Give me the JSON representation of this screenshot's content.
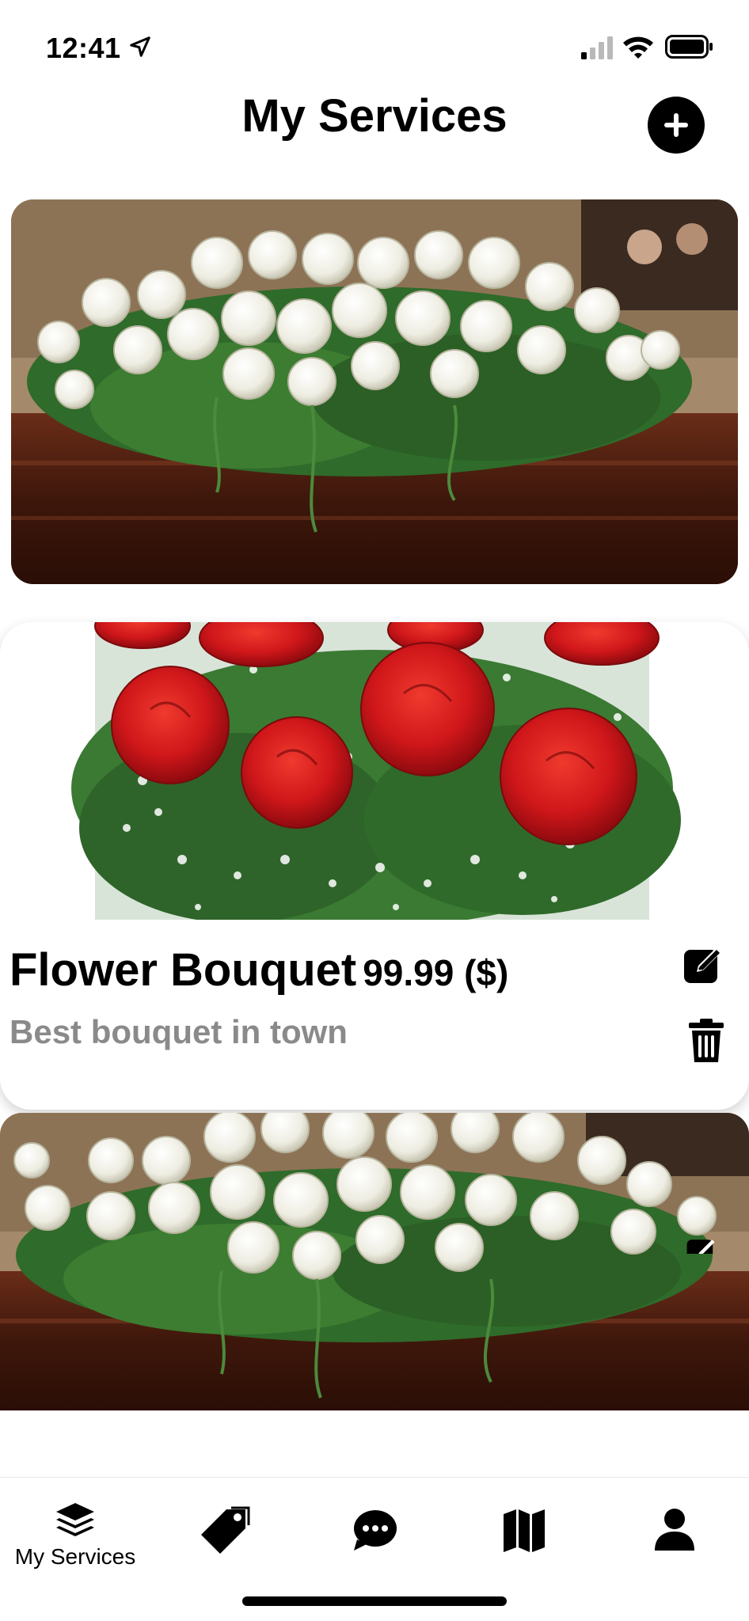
{
  "status_bar": {
    "time": "12:41",
    "location_icon": "location-arrow-icon",
    "signal_icon": "cellular-signal-icon",
    "wifi_icon": "wifi-icon",
    "battery_icon": "battery-icon"
  },
  "header": {
    "title": "My Services",
    "add_icon": "plus-circle-icon"
  },
  "services": [
    {
      "image": "white roses casket spray",
      "visible_info": false
    },
    {
      "image": "red roses bouquet",
      "name": "Flower Bouquet",
      "price": "99.99 ($)",
      "description": "Best bouquet in town",
      "edit_icon": "edit-icon",
      "delete_icon": "trash-icon"
    },
    {
      "image": "white roses casket spray",
      "visible_info": false
    }
  ],
  "tab_bar": {
    "tabs": [
      {
        "icon": "layers-icon",
        "label": "My Services",
        "active": true
      },
      {
        "icon": "tag-icon",
        "label": ""
      },
      {
        "icon": "chat-bubble-icon",
        "label": ""
      },
      {
        "icon": "map-icon",
        "label": ""
      },
      {
        "icon": "user-icon",
        "label": ""
      }
    ]
  },
  "colors": {
    "background": "#ffffff",
    "text_primary": "#000000",
    "text_secondary": "#8a8a8a",
    "rose_red": "#d61a1a",
    "rose_white": "#f4f3ec",
    "foliage": "#2f6b2a",
    "casket_wood": "#4a1f12"
  }
}
